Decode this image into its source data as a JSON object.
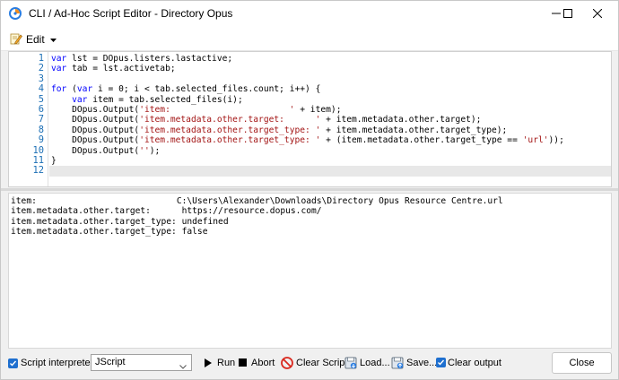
{
  "window": {
    "title": "CLI / Ad-Hoc Script Editor - Directory Opus",
    "app_icon": "directory-opus-logo",
    "controls": {
      "minimize": "minimize-icon",
      "maximize": "maximize-icon",
      "close": "close-icon"
    }
  },
  "toolbar": {
    "edit_label": "Edit",
    "edit_icon": "pencil-edit-icon"
  },
  "editor": {
    "line_numbers": [
      "1",
      "2",
      "3",
      "4",
      "5",
      "6",
      "7",
      "8",
      "9",
      "10",
      "11",
      "12"
    ],
    "lines": [
      "var lst = DOpus.listers.lastactive;",
      "var tab = lst.activetab;",
      "",
      "for (var i = 0; i < tab.selected_files.count; i++) {",
      "    var item = tab.selected_files(i);",
      "    DOpus.Output('item:                       ' + item);",
      "    DOpus.Output('item.metadata.other.target:      ' + item.metadata.other.target);",
      "    DOpus.Output('item.metadata.other.target_type: ' + item.metadata.other.target_type);",
      "    DOpus.Output('item.metadata.other.target_type: ' + (item.metadata.other.target_type == 'url'));",
      "    DOpus.Output('');",
      "}",
      ""
    ],
    "active_line": 12
  },
  "output": {
    "lines": [
      "item:                           C:\\Users\\Alexander\\Downloads\\Directory Opus Resource Centre.url",
      "item.metadata.other.target:      https://resource.dopus.com/",
      "item.metadata.other.target_type: undefined",
      "item.metadata.other.target_type: false"
    ]
  },
  "bottom": {
    "interpreter_label": "Script interpreter:",
    "interpreter_checked": true,
    "interpreter_value": "JScript",
    "run_label": "Run",
    "abort_label": "Abort",
    "clear_script_label": "Clear Script",
    "load_label": "Load...",
    "save_label": "Save...",
    "clear_output_label": "Clear output",
    "clear_output_checked": true,
    "close_label": "Close"
  },
  "colors": {
    "keyword": "#0000ff",
    "string": "#a31515",
    "line_number": "#1c6fb5",
    "checkbox": "#1e6fcf"
  }
}
